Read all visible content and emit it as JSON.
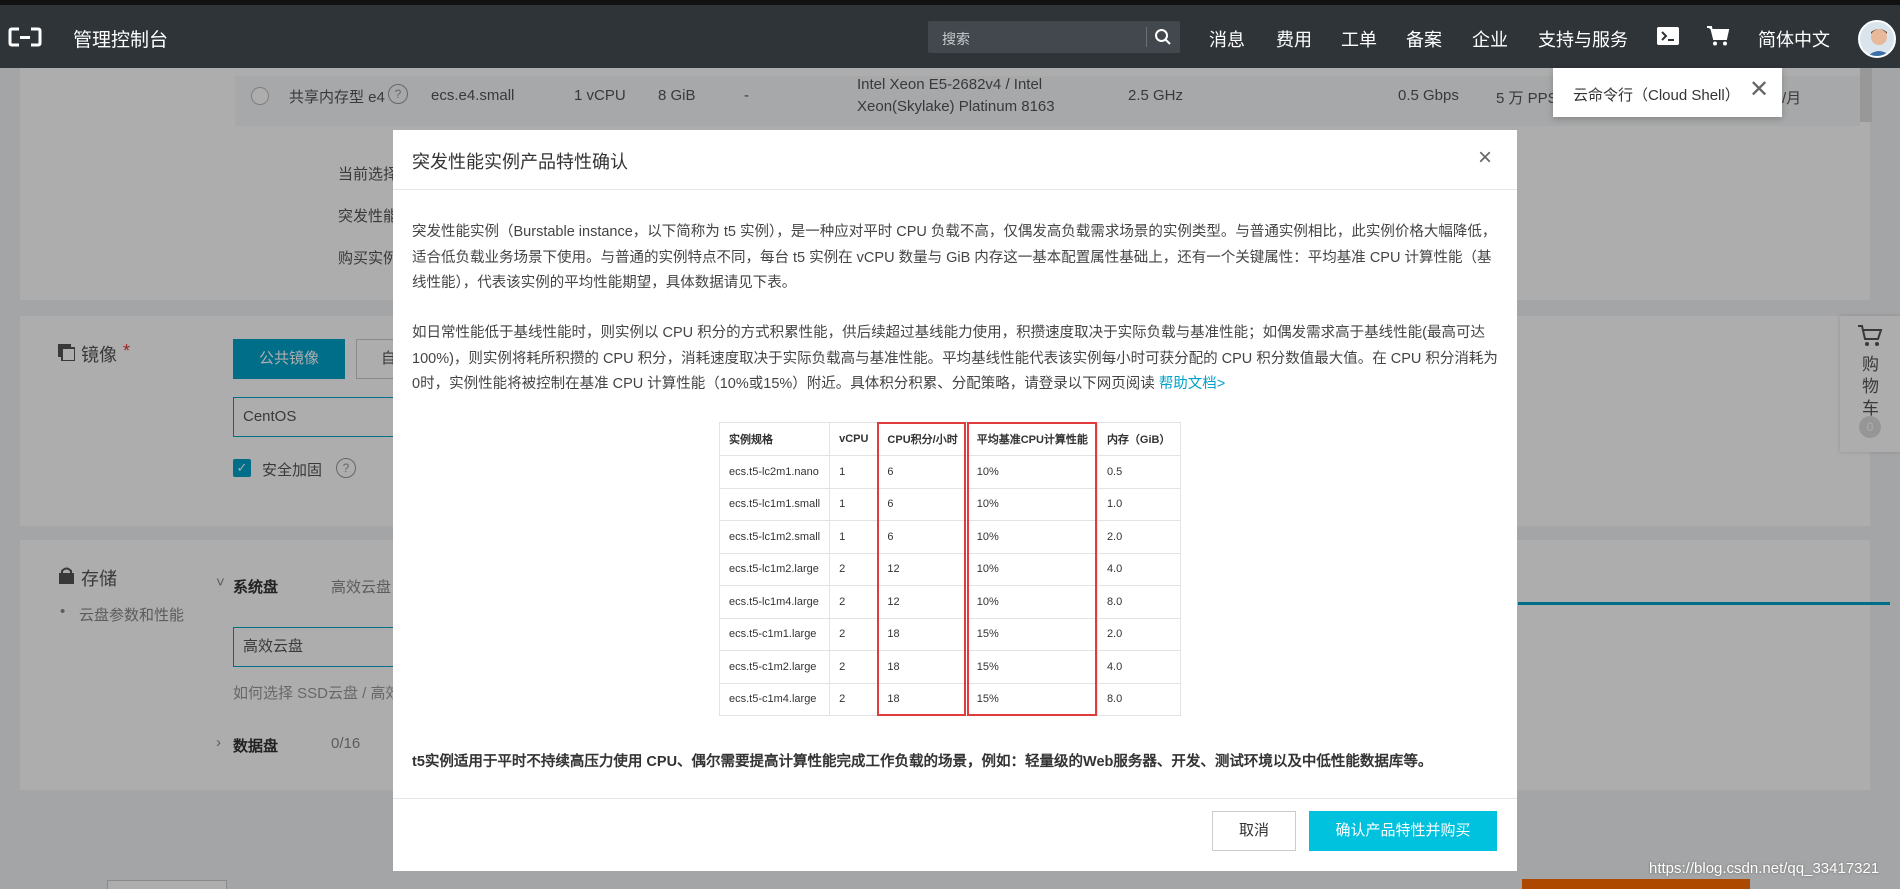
{
  "topbar": {
    "brand": "管理控制台",
    "search_placeholder": "搜索",
    "nav": [
      "消息",
      "费用",
      "工单",
      "备案",
      "企业",
      "支持与服务"
    ],
    "language": "简体中文",
    "icons": [
      "aliyun-logo-icon",
      "search-icon",
      "cloud-shell-icon",
      "cart-icon",
      "avatar"
    ]
  },
  "background": {
    "instance_row": {
      "name": "共享内存型 e4",
      "spec": "ecs.e4.small",
      "vcpu": "1 vCPU",
      "mem": "8 GiB",
      "dash": "-",
      "cpu_model_1": "Intel Xeon E5-2682v4 / Intel",
      "cpu_model_2": "Xeon(Skylake) Platinum 8163",
      "freq": "2.5 GHz",
      "bandwidth": "0.5 Gbps",
      "pps": "5 万 PPS",
      "price_suffix": "/月"
    },
    "labels_partial": [
      "当前选择",
      "突发性能",
      "购买实例"
    ],
    "image_section": {
      "title": "镜像",
      "required": "*",
      "tab_public": "公共镜像",
      "tab_custom": "自",
      "os_value": "CentOS",
      "security_label": "安全加固"
    },
    "storage_section": {
      "title": "存储",
      "bullet": "云盘参数和性能",
      "system_disk": "系统盘",
      "cloud_disk_tab": "高效云盘",
      "disk_select": "高效云盘",
      "hint": "如何选择 SSD云盘 / 高效",
      "data_disk": "数据盘",
      "data_disk_count": "0/16"
    },
    "side_cart": {
      "label": "购物车",
      "count": "0"
    }
  },
  "tooltip": {
    "text": "云命令行（Cloud Shell）",
    "close": "✕"
  },
  "modal": {
    "title": "突发性能实例产品特性确认",
    "close": "×",
    "para1": "突发性能实例（Burstable instance，以下简称为 t5 实例），是一种应对平时 CPU 负载不高，仅偶发高负载需求场景的实例类型。与普通实例相比，此实例价格大幅降低，适合低负载业务场景下使用。与普通的实例特点不同，每台 t5 实例在 vCPU 数量与 GiB 内存这一基本配置属性基础上，还有一个关键属性：平均基准 CPU 计算性能（基线性能），代表该实例的平均性能期望，具体数据请见下表。",
    "para2": "如日常性能低于基线性能时，则实例以 CPU 积分的方式积累性能，供后续超过基线能力使用，积攒速度取决于实际负载与基准性能；如偶发需求高于基线性能(最高可达100%)，则实例将耗所积攒的 CPU 积分，消耗速度取决于实际负载高与基准性能。平均基线性能代表该实例每小时可获分配的 CPU 积分数值最大值。在 CPU 积分消耗为0时，实例性能将被控制在基准 CPU 计算性能（10%或15%）附近。具体积分积累、分配策略，请登录以下网页阅读 ",
    "help_link": "帮助文档>",
    "table": {
      "headers": [
        "实例规格",
        "vCPU",
        "CPU积分/小时",
        "平均基准CPU计算性能",
        "内存（GiB）"
      ],
      "rows": [
        [
          "ecs.t5-lc2m1.nano",
          "1",
          "6",
          "10%",
          "0.5"
        ],
        [
          "ecs.t5-lc1m1.small",
          "1",
          "6",
          "10%",
          "1.0"
        ],
        [
          "ecs.t5-lc1m2.small",
          "1",
          "6",
          "10%",
          "2.0"
        ],
        [
          "ecs.t5-lc1m2.large",
          "2",
          "12",
          "10%",
          "4.0"
        ],
        [
          "ecs.t5-lc1m4.large",
          "2",
          "12",
          "10%",
          "8.0"
        ],
        [
          "ecs.t5-c1m1.large",
          "2",
          "18",
          "15%",
          "2.0"
        ],
        [
          "ecs.t5-c1m2.large",
          "2",
          "18",
          "15%",
          "4.0"
        ],
        [
          "ecs.t5-c1m4.large",
          "2",
          "18",
          "15%",
          "8.0"
        ]
      ],
      "highlight_color": "#e03c3c"
    },
    "summary": "t5实例适用于平时不持续高压力使用 CPU、偶尔需要提高计算性能完成工作负载的场景，例如：轻量级的Web服务器、开发、测试环境以及中低性能数据库等。",
    "cancel": "取消",
    "confirm": "确认产品特性并购买",
    "accent_color": "#00c1de"
  },
  "watermark": "https://blog.csdn.net/qq_33417321"
}
